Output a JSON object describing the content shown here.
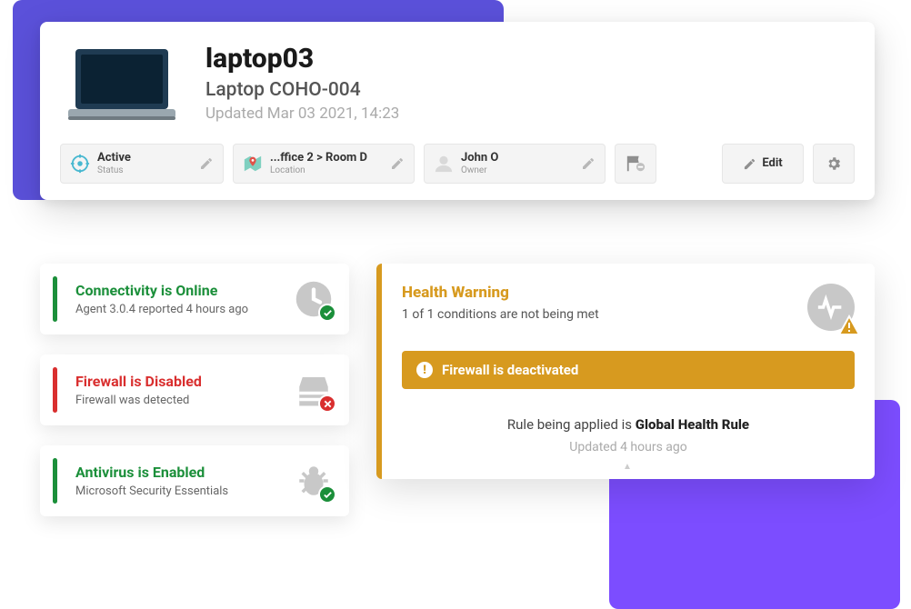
{
  "device": {
    "name": "laptop03",
    "label": "Laptop COHO-004",
    "updated_prefix": "Updated ",
    "updated": "Mar 03 2021, 14:23"
  },
  "info": {
    "status": {
      "value": "Active",
      "label": "Status"
    },
    "location": {
      "value": "...ffice 2 > Room D",
      "label": "Location"
    },
    "owner": {
      "value": "John O",
      "label": "Owner"
    },
    "edit_label": "Edit"
  },
  "status_cards": {
    "connectivity": {
      "title": "Connectivity is Online",
      "sub": "Agent 3.0.4 reported 4 hours ago"
    },
    "firewall": {
      "title": "Firewall is Disabled",
      "sub": "Firewall was detected"
    },
    "antivirus": {
      "title": "Antivirus is Enabled",
      "sub": "Microsoft Security Essentials"
    }
  },
  "health": {
    "title": "Health Warning",
    "sub": "1 of 1 conditions are not being met",
    "alert": "Firewall is deactivated",
    "rule_prefix": "Rule being applied is ",
    "rule_name": "Global Health Rule",
    "updated": "Updated 4 hours ago"
  }
}
